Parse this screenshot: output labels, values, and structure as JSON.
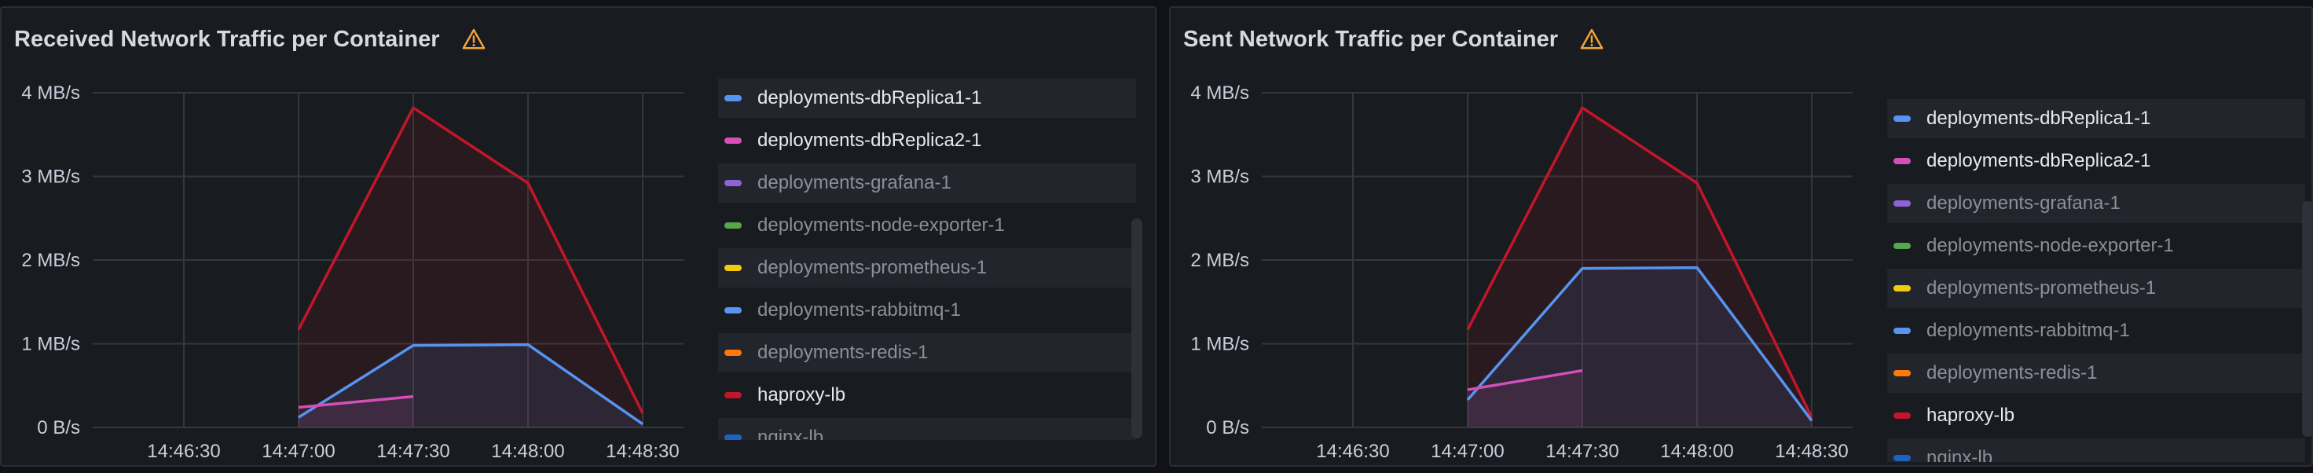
{
  "panels": [
    {
      "title": "Received Network Traffic per Container",
      "warning_icon": "warning-triangle-icon",
      "warning_color": "#f2a33a",
      "y_ticks": [
        "4 MB/s",
        "3 MB/s",
        "2 MB/s",
        "1 MB/s",
        "0 B/s"
      ],
      "x_ticks": [
        "14:46:30",
        "14:47:00",
        "14:47:30",
        "14:48:00",
        "14:48:30"
      ],
      "legend": [
        {
          "name": "deployments-dbReplica1-1",
          "color": "#5794f2",
          "active": true
        },
        {
          "name": "deployments-dbReplica2-1",
          "color": "#d64fb8",
          "active": true
        },
        {
          "name": "deployments-grafana-1",
          "color": "#8f63d4",
          "active": false
        },
        {
          "name": "deployments-node-exporter-1",
          "color": "#56a64b",
          "active": false
        },
        {
          "name": "deployments-prometheus-1",
          "color": "#f2cc0c",
          "active": false
        },
        {
          "name": "deployments-rabbitmq-1",
          "color": "#5794f2",
          "active": false
        },
        {
          "name": "deployments-redis-1",
          "color": "#ff780a",
          "active": false
        },
        {
          "name": "haproxy-lb",
          "color": "#c4162a",
          "active": true
        },
        {
          "name": "nginx-lb",
          "color": "#1f60c4",
          "active": false
        }
      ],
      "chart_data": {
        "type": "area",
        "y_unit": "MB/s",
        "ylim": [
          0,
          4
        ],
        "x_ticks": [
          "14:46:30",
          "14:47:00",
          "14:47:30",
          "14:48:00",
          "14:48:30"
        ],
        "series": [
          {
            "name": "haproxy-lb",
            "color": "#c4162a",
            "points": [
              [
                "14:47:00",
                1.17
              ],
              [
                "14:47:30",
                3.82
              ],
              [
                "14:48:00",
                2.92
              ],
              [
                "14:48:30",
                0.17
              ]
            ]
          },
          {
            "name": "deployments-dbReplica1-1",
            "color": "#5794f2",
            "points": [
              [
                "14:47:00",
                0.12
              ],
              [
                "14:47:30",
                0.98
              ],
              [
                "14:48:00",
                0.99
              ],
              [
                "14:48:30",
                0.04
              ]
            ]
          },
          {
            "name": "deployments-dbReplica2-1",
            "color": "#d64fb8",
            "points": [
              [
                "14:47:00",
                0.24
              ],
              [
                "14:47:30",
                0.37
              ]
            ]
          }
        ]
      }
    },
    {
      "title": "Sent Network Traffic per Container",
      "warning_icon": "warning-triangle-icon",
      "warning_color": "#f2a33a",
      "y_ticks": [
        "4 MB/s",
        "3 MB/s",
        "2 MB/s",
        "1 MB/s",
        "0 B/s"
      ],
      "x_ticks": [
        "14:46:30",
        "14:47:00",
        "14:47:30",
        "14:48:00",
        "14:48:30"
      ],
      "legend": [
        {
          "name": "deployments-dbReplica1-1",
          "color": "#5794f2",
          "active": true
        },
        {
          "name": "deployments-dbReplica2-1",
          "color": "#d64fb8",
          "active": true
        },
        {
          "name": "deployments-grafana-1",
          "color": "#8f63d4",
          "active": false
        },
        {
          "name": "deployments-node-exporter-1",
          "color": "#56a64b",
          "active": false
        },
        {
          "name": "deployments-prometheus-1",
          "color": "#f2cc0c",
          "active": false
        },
        {
          "name": "deployments-rabbitmq-1",
          "color": "#5794f2",
          "active": false
        },
        {
          "name": "deployments-redis-1",
          "color": "#ff780a",
          "active": false
        },
        {
          "name": "haproxy-lb",
          "color": "#c4162a",
          "active": true
        },
        {
          "name": "nginx-lb",
          "color": "#1f60c4",
          "active": false
        }
      ],
      "chart_data": {
        "type": "area",
        "y_unit": "MB/s",
        "ylim": [
          0,
          4
        ],
        "x_ticks": [
          "14:46:30",
          "14:47:00",
          "14:47:30",
          "14:48:00",
          "14:48:30"
        ],
        "series": [
          {
            "name": "haproxy-lb",
            "color": "#c4162a",
            "points": [
              [
                "14:47:00",
                1.17
              ],
              [
                "14:47:30",
                3.82
              ],
              [
                "14:48:00",
                2.92
              ],
              [
                "14:48:30",
                0.12
              ]
            ]
          },
          {
            "name": "deployments-dbReplica1-1",
            "color": "#5794f2",
            "points": [
              [
                "14:47:00",
                0.33
              ],
              [
                "14:47:30",
                1.9
              ],
              [
                "14:48:00",
                1.91
              ],
              [
                "14:48:30",
                0.08
              ]
            ]
          },
          {
            "name": "deployments-dbReplica2-1",
            "color": "#d64fb8",
            "points": [
              [
                "14:47:00",
                0.45
              ],
              [
                "14:47:30",
                0.68
              ]
            ]
          }
        ]
      }
    }
  ]
}
